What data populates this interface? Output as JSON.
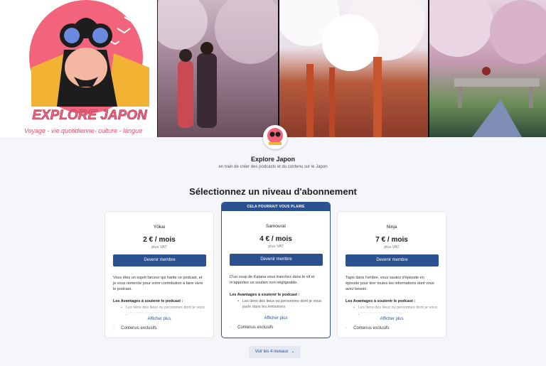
{
  "banner": {
    "logo_title": "EXPLORE JAPON",
    "logo_subtitle": "Voyage - vie quotidienne- culture - langue"
  },
  "creator": {
    "name": "Explore Japon",
    "tagline": "en train de créer des podcasts et du contenu sur le Japon"
  },
  "section_title": "Sélectionnez un niveau d'abonnement",
  "tiers": [
    {
      "name": "Yōkai",
      "price": "2 € / mois",
      "vat": "plus VAT",
      "button": "Devenir membre",
      "description": "Vous êtes un esprit farceur qui hante ce podcast, et je vous remercie pour votre contribution à faire vivre le podcast.",
      "benefits_title": "Les Avantages à soutenir le podcast :",
      "benefit_1": "Les liens des lieux ou personnes dont je vous parle dans les émissions",
      "show_more": "Afficher plus",
      "exclusive": "Contenus exclusifs"
    },
    {
      "ribbon": "CELA POURRAIT VOUS PLAIRE",
      "name": "Samouraï",
      "price": "4 € / mois",
      "vat": "plus VAT",
      "button": "Devenir membre",
      "description": "D'un coup de Katana vous tranchez dans le vif et m'apportez un soutien non négligeable.",
      "benefits_title": "Les Avantages à soutenir le podcast :",
      "benefit_1": "Les liens des lieux ou personnes dont je vous parle dans les émissions",
      "show_more": "Afficher plus",
      "exclusive": "Contenus exclusifs"
    },
    {
      "name": "Ninja",
      "price": "7 € / mois",
      "vat": "plus VAT",
      "button": "Devenir membre",
      "description": "Tapis dans l'ombre, vous sautez d'épisode en épisode pour tirer toutes les informations dont vous avez besoin.",
      "benefits_title": "Les Avantages à soutenir le podcast :",
      "benefit_1": "Les liens des lieux ou personnes dont je vous parle dans les émissions",
      "show_more": "Afficher plus",
      "exclusive": "Contenus exclusifs"
    }
  ],
  "see_levels": "Voir les 4 niveaux",
  "colors": {
    "accent": "#2c5190",
    "logo_pink": "#f2637c",
    "logo_yellow": "#f2b233"
  },
  "icons": {
    "expand": "chevron-down-icon"
  }
}
